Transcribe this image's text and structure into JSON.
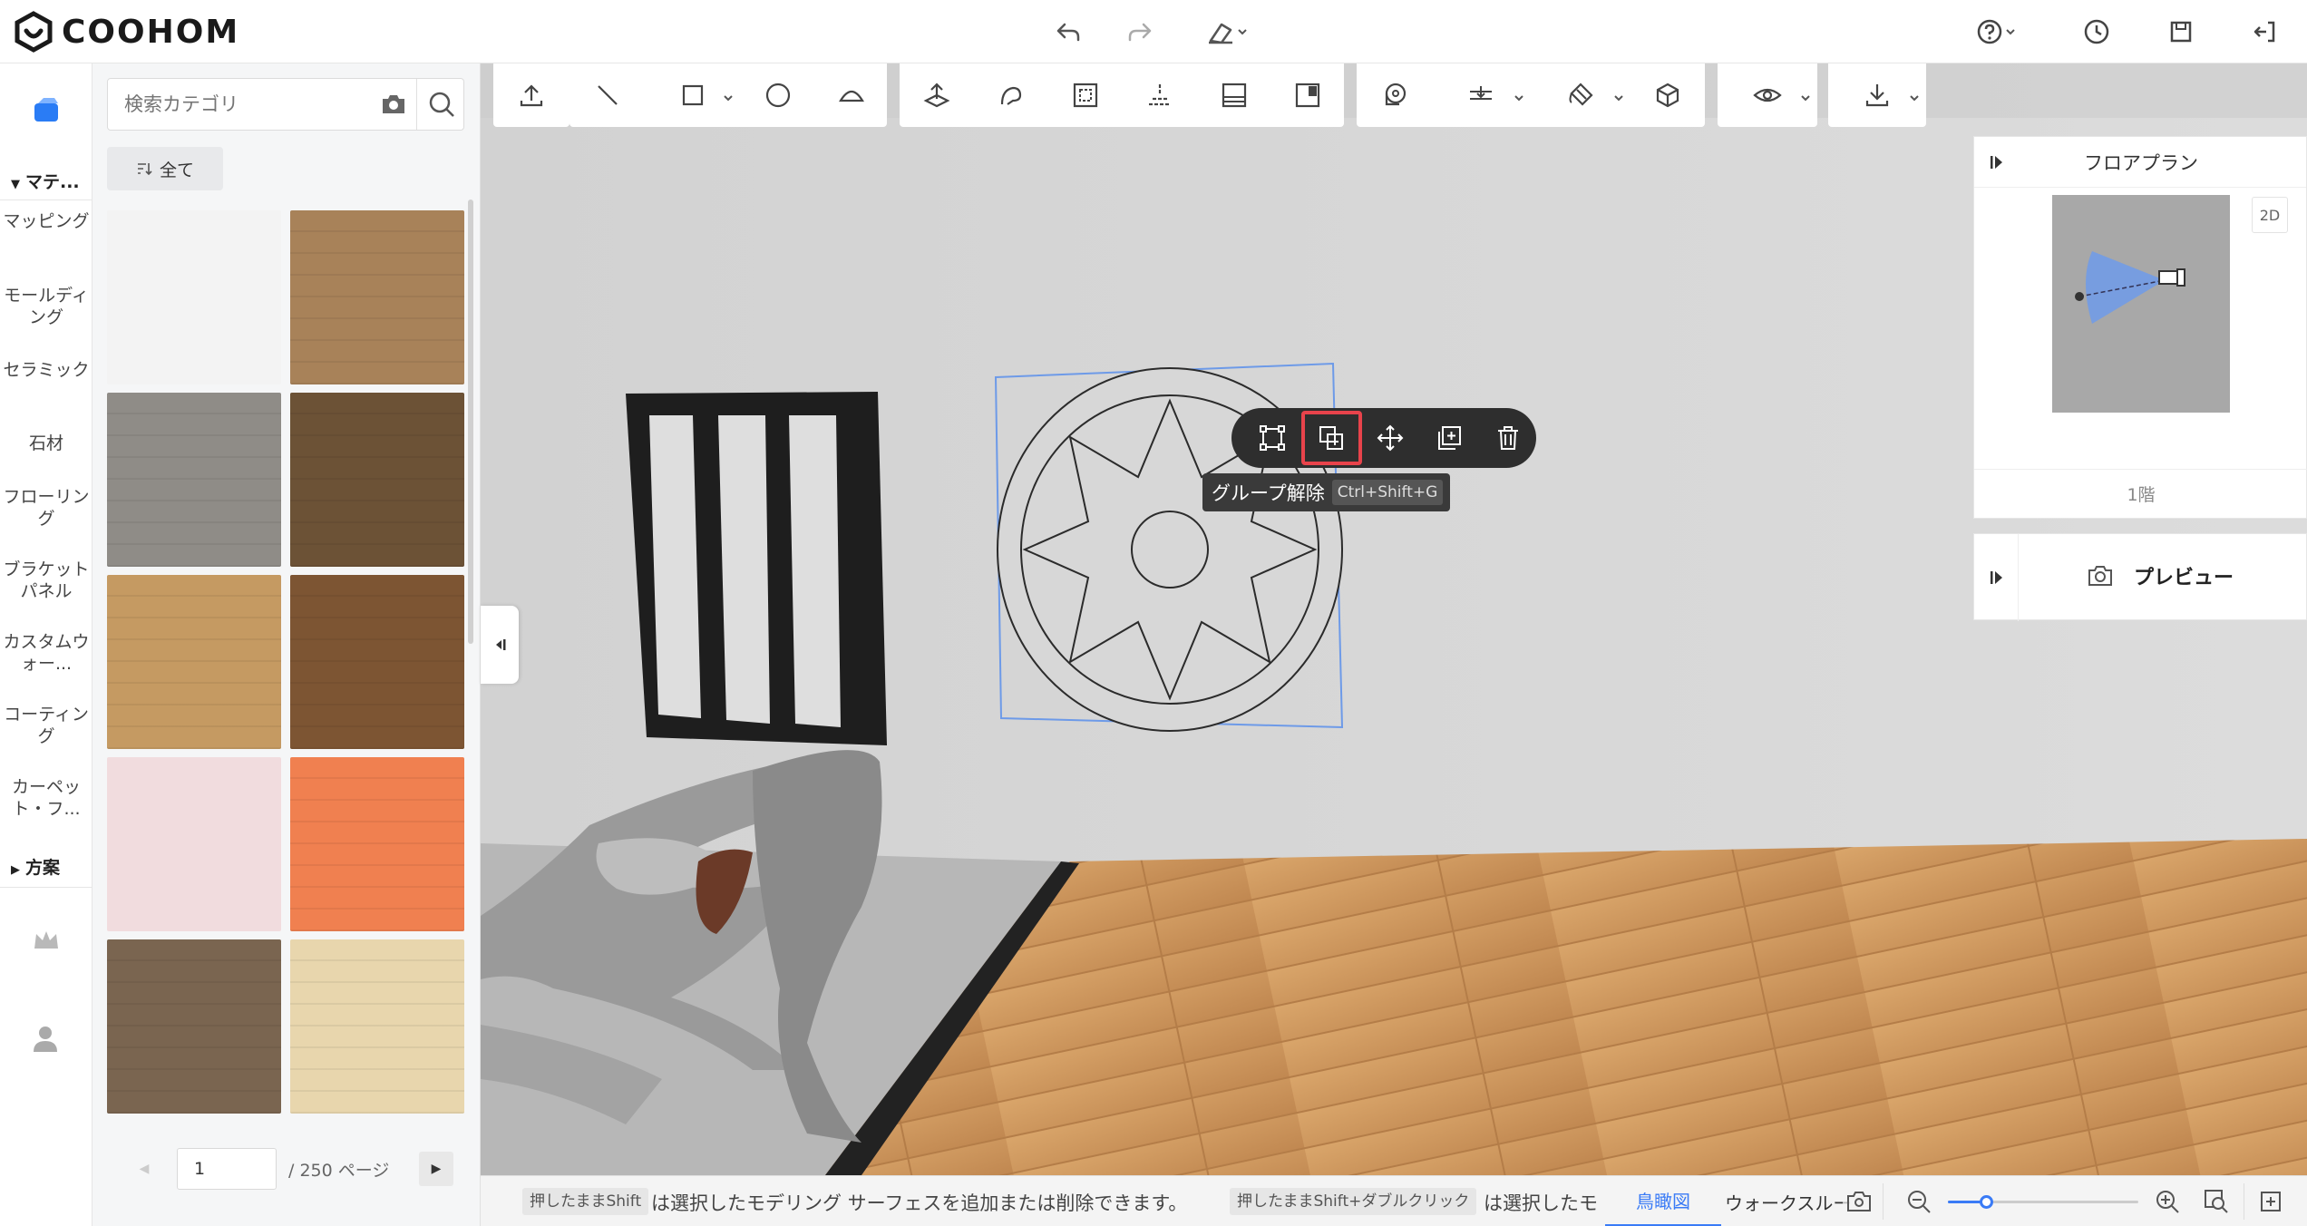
{
  "app": {
    "logo_text": "COOHOM"
  },
  "topbar": {
    "left_icons": [
      "undo-icon",
      "redo-icon",
      "eraser-icon"
    ],
    "right_icons": [
      "help-icon",
      "history-icon",
      "save-icon",
      "exit-icon"
    ]
  },
  "nav": {
    "section_materials": "マテ...",
    "items": [
      "マッピング",
      "モールディング",
      "セラミック",
      "石材",
      "フローリング",
      "ブラケットパネル",
      "カスタムウォー...",
      "コーティング",
      "カーペット・フ..."
    ],
    "section_plans": "方案"
  },
  "materials": {
    "search_placeholder": "検索カテゴリ",
    "filter_label": "全て",
    "swatches": [
      {
        "name": "white-marble",
        "color": "#f3f3f3"
      },
      {
        "name": "oak-wood",
        "color": "#a88259"
      },
      {
        "name": "grey-wood",
        "color": "#8f8c87"
      },
      {
        "name": "dark-wood",
        "color": "#6c5236"
      },
      {
        "name": "light-oak",
        "color": "#c59a62"
      },
      {
        "name": "walnut-wood",
        "color": "#7d5533"
      },
      {
        "name": "pink-marble",
        "color": "#f1dcde"
      },
      {
        "name": "orange-plaster",
        "color": "#f08050"
      },
      {
        "name": "rustic-wood",
        "color": "#7a6550"
      },
      {
        "name": "sand-tile",
        "color": "#e8d6ad"
      }
    ],
    "pager": {
      "page": "1",
      "total": "/ 250 ページ"
    }
  },
  "context_toolbar": {
    "buttons": [
      "transform-icon",
      "ungroup-icon",
      "move-icon",
      "duplicate-icon",
      "delete-icon"
    ],
    "tooltip_label": "グループ解除",
    "tooltip_shortcut": "Ctrl+Shift+G"
  },
  "floorplan": {
    "title": "フロアプラン",
    "mode_badge": "2D",
    "floor_label": "1階"
  },
  "preview": {
    "title": "プレビュー"
  },
  "status": {
    "tag1": "押したままShift",
    "text1": "は選択したモデリング サーフェスを追加または削除できます。",
    "tag2": "押したままShift+ダブルクリック",
    "text2": "は選択したモ",
    "tab_birdseye": "鳥瞰図",
    "tab_walkthrough": "ウォークスルー",
    "zoom_level": 0.2,
    "accent": "#3a7bf6"
  }
}
